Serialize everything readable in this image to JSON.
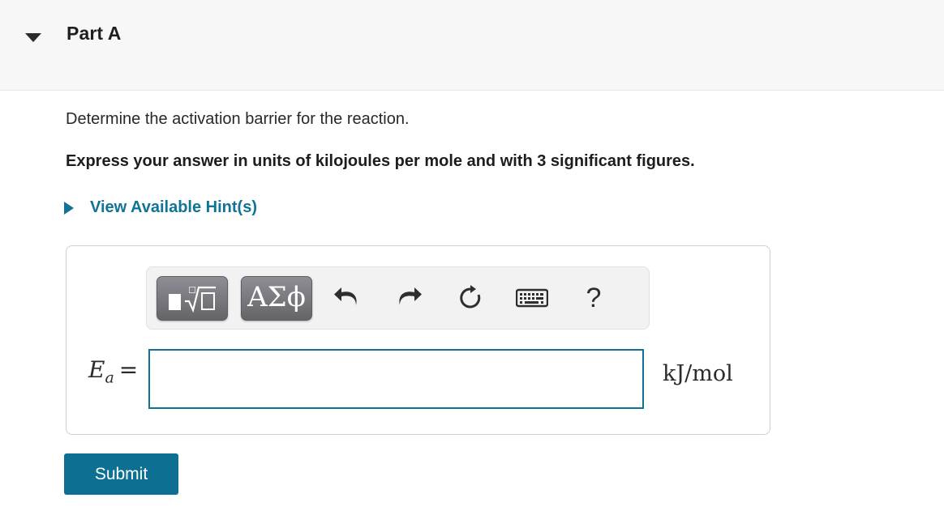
{
  "part": {
    "title": "Part A",
    "toggle_icon": "caret-down-icon",
    "expanded": true
  },
  "question": {
    "prompt": "Determine the activation barrier for the reaction.",
    "instruction": "Express your answer in units of kilojoules per mole and with 3 significant figures."
  },
  "hints": {
    "label": "View Available Hint(s)",
    "icon": "caret-right-icon",
    "color": "#117396"
  },
  "answer_panel": {
    "toolbar": {
      "buttons": [
        {
          "name": "math-template-button",
          "label": "■√□",
          "tooltip": "Math templates"
        },
        {
          "name": "greek-letters-button",
          "label": "ΑΣϕ",
          "tooltip": "Greek letters"
        },
        {
          "name": "undo-button",
          "label": "undo-icon",
          "tooltip": "Undo"
        },
        {
          "name": "redo-button",
          "label": "redo-icon",
          "tooltip": "Redo"
        },
        {
          "name": "reset-button",
          "label": "reset-icon",
          "tooltip": "Reset"
        },
        {
          "name": "keyboard-button",
          "label": "keyboard-icon",
          "tooltip": "Keyboard shortcuts"
        },
        {
          "name": "help-button",
          "label": "?",
          "tooltip": "Help"
        }
      ]
    },
    "variable_label": "E",
    "variable_subscript": "a",
    "equals_sign": "=",
    "input_value": "",
    "input_placeholder": "",
    "units": "kJ/mol",
    "border_color": "#0e7395"
  },
  "actions": {
    "submit_label": "Submit",
    "submit_color": "#0d7093"
  }
}
